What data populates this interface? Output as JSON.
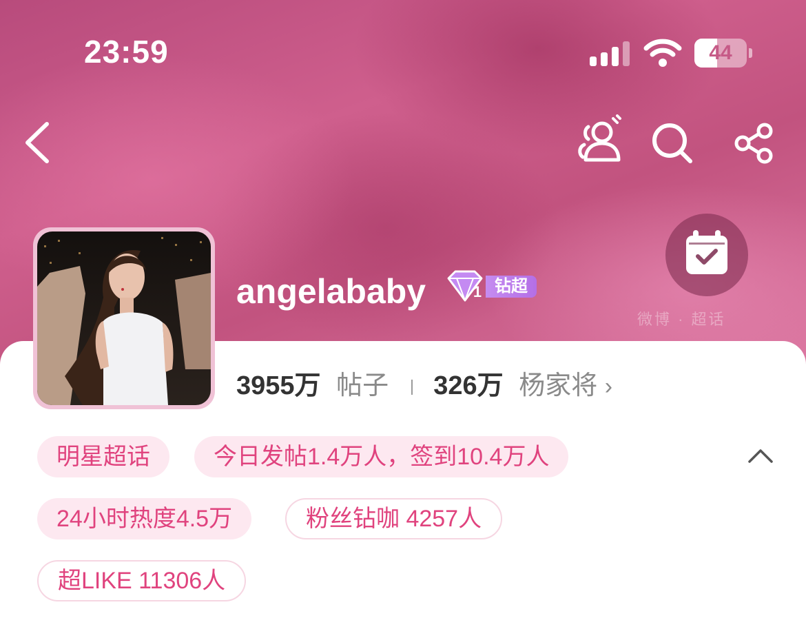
{
  "status_bar": {
    "time": "23:59",
    "battery_level": "44",
    "battery_percent": 44,
    "signal_bars_active": 3,
    "signal_bars_total": 4,
    "icons": [
      "cellular-signal-icon",
      "wifi-icon",
      "battery-icon"
    ]
  },
  "nav": {
    "icons": [
      "back-chevron-icon",
      "super-fans-icon",
      "search-icon",
      "share-icon"
    ]
  },
  "profile": {
    "username": "angelababy",
    "badge_level": "1",
    "badge_label": "钻超",
    "avatar_icon": "avatar-photo",
    "checkin_icon": "calendar-check-icon",
    "watermark": "微博 · 超话"
  },
  "stats": {
    "posts_value": "3955万",
    "posts_label": "帖子",
    "fans_value": "326万",
    "fans_label": "杨家将",
    "more_icon": "chevron-right-icon"
  },
  "tags": {
    "category": "明星超话",
    "today": "今日发帖1.4万人，签到10.4万人",
    "heat": "24小时热度4.5万",
    "diamond": "粉丝钻咖 4257人",
    "superlike": "超LIKE 11306人",
    "collapse_icon": "chevron-up-icon"
  },
  "colors": {
    "header_base": "#c95b89",
    "tag_text": "#e0437e",
    "tag_fill": "#fde8f0",
    "tag_border": "#f6d6e2",
    "badge_purple": "#b46fe6",
    "stat_value": "#333333",
    "stat_label": "#8a8a8a"
  }
}
